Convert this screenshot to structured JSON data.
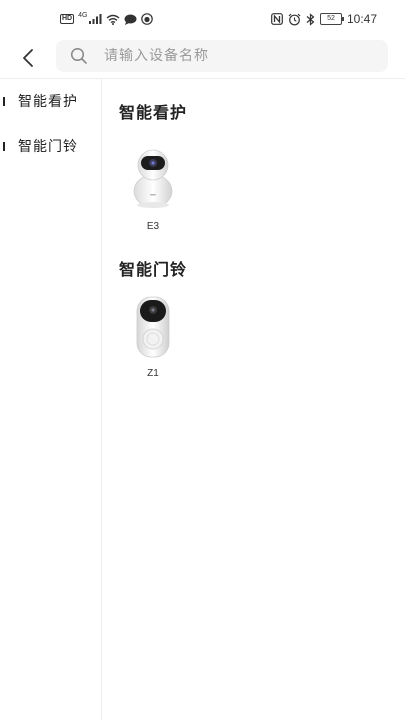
{
  "status_bar": {
    "network_badge": "HD",
    "network_type": "4G",
    "battery_level": "52",
    "time": "10:47",
    "icons": [
      "hd-icon",
      "signal-icon",
      "wifi-icon",
      "chat-icon",
      "app-icon",
      "nfc-icon",
      "alarm-icon",
      "bluetooth-icon",
      "battery-icon"
    ]
  },
  "header": {
    "back_icon": "chevron-left-icon",
    "search_icon": "search-icon",
    "search_placeholder": "请输入设备名称",
    "search_value": ""
  },
  "sidebar": {
    "items": [
      {
        "label": "智能看护"
      },
      {
        "label": "智能门铃"
      }
    ]
  },
  "main": {
    "sections": [
      {
        "title": "智能看护",
        "devices": [
          {
            "label": "E3",
            "icon": "pan-tilt-camera-icon"
          }
        ]
      },
      {
        "title": "智能门铃",
        "devices": [
          {
            "label": "Z1",
            "icon": "video-doorbell-icon"
          }
        ]
      }
    ]
  },
  "colors": {
    "background": "#ffffff",
    "search_bg": "#f5f5f5",
    "divider": "#eeeeee",
    "text_primary": "#222222",
    "placeholder": "#9a9a9a"
  }
}
